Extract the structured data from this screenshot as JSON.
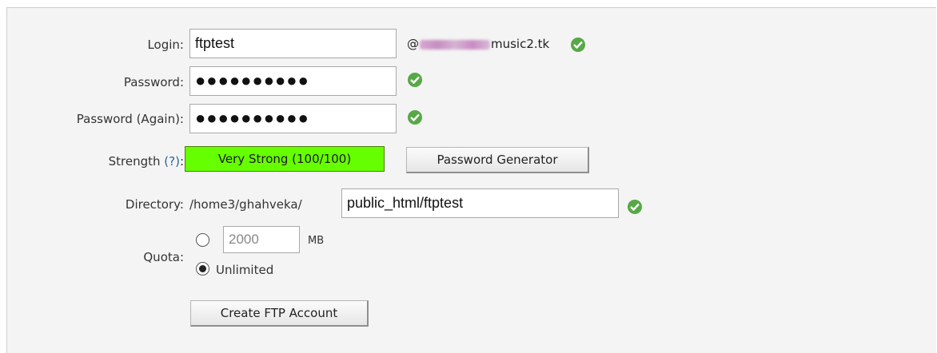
{
  "form": {
    "login": {
      "label": "Login:",
      "value": "ftptest",
      "domain_prefix": "@",
      "domain_suffix": "music2.tk"
    },
    "password": {
      "label": "Password:",
      "value": "●●●●●●●●●●"
    },
    "password_again": {
      "label": "Password (Again):",
      "value": "●●●●●●●●●●"
    },
    "strength": {
      "label": "Strength",
      "help": "(?)",
      "colon": ":",
      "value": "Very Strong (100/100)",
      "color": "#66ff00"
    },
    "generator_button": "Password Generator",
    "directory": {
      "label": "Directory:",
      "prefix": "/home3/ghahveka/",
      "value": "public_html/ftptest"
    },
    "quota": {
      "label": "Quota:",
      "limit_value": "2000",
      "unit": "MB",
      "unlimited_label": "Unlimited",
      "selected": "Unlimited"
    },
    "submit_button": "Create FTP Account"
  },
  "colors": {
    "valid_check": "#57a846",
    "panel_bg": "#f4f4f4"
  }
}
